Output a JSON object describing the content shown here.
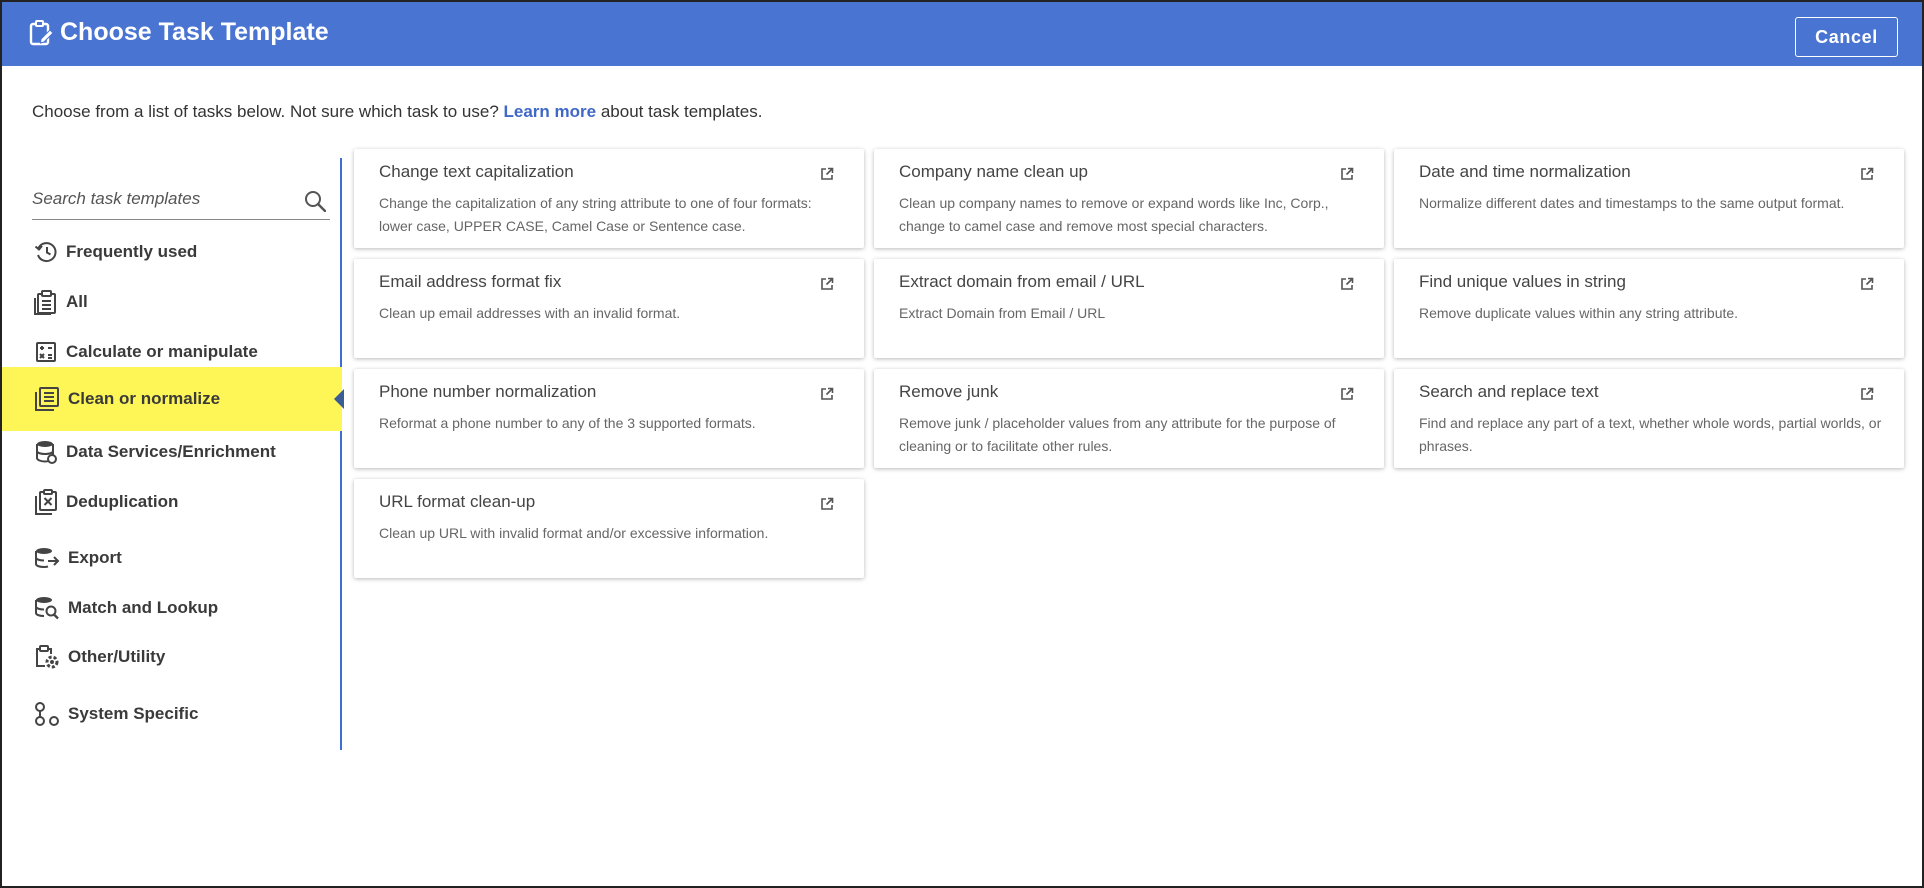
{
  "header": {
    "title": "Choose Task Template",
    "cancel_label": "Cancel"
  },
  "intro": {
    "before": "Choose from a list of tasks below. Not sure which task to use?",
    "link": "Learn more",
    "after": "about task templates."
  },
  "search": {
    "placeholder": "Search task templates",
    "value": ""
  },
  "sidebar": {
    "items": [
      {
        "label": "Frequently used",
        "icon": "history-icon"
      },
      {
        "label": "All",
        "icon": "clipboard-list-icon"
      },
      {
        "label": "Calculate or manipulate",
        "icon": "calculator-icon"
      },
      {
        "label": "Clean or normalize",
        "icon": "clean-list-icon",
        "active": true
      },
      {
        "label": "Data Services/Enrichment",
        "icon": "database-icon"
      },
      {
        "label": "Deduplication",
        "icon": "deduplicate-icon"
      },
      {
        "label": "Export",
        "icon": "database-export-icon"
      },
      {
        "label": "Match and Lookup",
        "icon": "database-search-icon"
      },
      {
        "label": "Other/Utility",
        "icon": "clipboard-gear-icon"
      },
      {
        "label": "System Specific",
        "icon": "system-nodes-icon"
      }
    ]
  },
  "cards": [
    {
      "title": "Change text capitalization",
      "desc": "Change the capitalization of any string attribute to one of four formats: lower case, UPPER CASE, Camel Case or Sentence case."
    },
    {
      "title": "Company name clean up",
      "desc": "Clean up company names to remove or expand words like Inc, Corp., change to camel case and remove most special characters."
    },
    {
      "title": "Date and time normalization",
      "desc": "Normalize different dates and timestamps to the same output format."
    },
    {
      "title": "Email address format fix",
      "desc": "Clean up email addresses with an invalid format."
    },
    {
      "title": "Extract domain from email / URL",
      "desc": "Extract Domain from Email / URL"
    },
    {
      "title": "Find unique values in string",
      "desc": "Remove duplicate values within any string attribute."
    },
    {
      "title": "Phone number normalization",
      "desc": "Reformat a phone number to any of the 3 supported formats."
    },
    {
      "title": "Remove junk",
      "desc": "Remove junk / placeholder values from any attribute for the purpose of cleaning or to facilitate other rules."
    },
    {
      "title": "Search and replace text",
      "desc": "Find and replace any part of a text, whether whole words, partial worlds, or phrases."
    },
    {
      "title": "URL format clean-up",
      "desc": "Clean up URL with invalid format and/or excessive information."
    }
  ],
  "colors": {
    "header": "#4a74d1",
    "active_item": "#fef556",
    "link": "#3f68c7",
    "divider": "#3b6fd0"
  }
}
